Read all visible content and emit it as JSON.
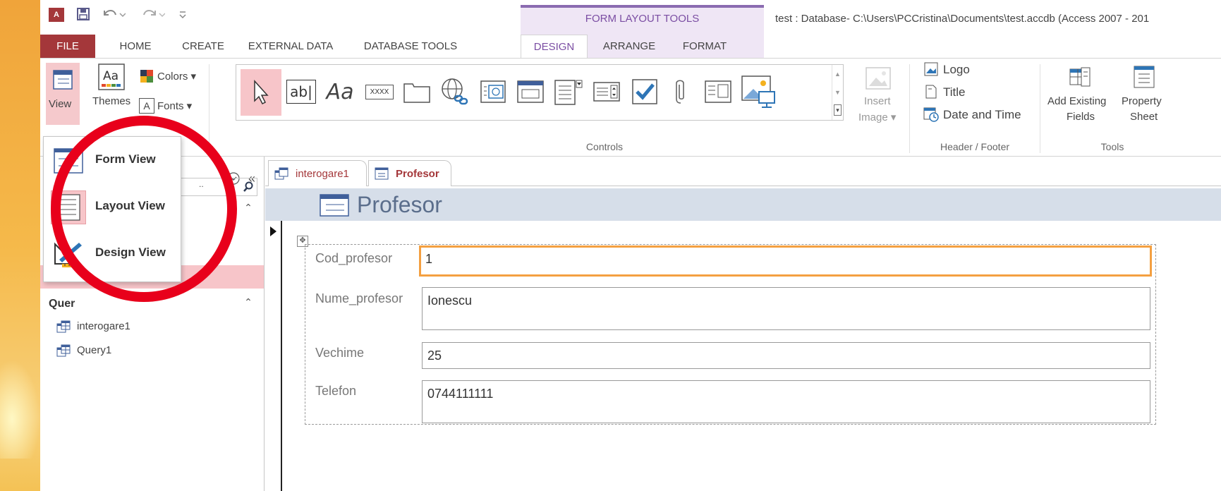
{
  "window": {
    "context_group": "FORM LAYOUT TOOLS",
    "title": "test : Database- C:\\Users\\PCCristina\\Documents\\test.accdb (Access 2007 - 201",
    "app_logo": "A"
  },
  "tabs": {
    "file": "FILE",
    "home": "HOME",
    "create": "CREATE",
    "external_data": "EXTERNAL DATA",
    "database_tools": "DATABASE TOOLS",
    "design": "DESIGN",
    "arrange": "ARRANGE",
    "format": "FORMAT"
  },
  "ribbon": {
    "view": "View",
    "themes": "Themes",
    "colors": "Colors",
    "fonts": "Fonts",
    "controls_label": "Controls",
    "insert_image_1": "Insert",
    "insert_image_2": "Image",
    "logo": "Logo",
    "title": "Title",
    "date_time": "Date and Time",
    "header_footer_label": "Header / Footer",
    "add_existing_1": "Add Existing",
    "add_existing_2": "Fields",
    "property_1": "Property",
    "property_2": "Sheet",
    "tools_label": "Tools",
    "textbox_glyph": "ab|",
    "label_glyph": "Aa",
    "xxxx_glyph": "XXXX"
  },
  "view_menu": {
    "form_view": "Form View",
    "layout_view": "Layout View",
    "design_view": "Design View"
  },
  "nav": {
    "queries_header": "Quer",
    "items": [
      "interogare1",
      "Query1"
    ]
  },
  "doc_tabs": [
    "interogare1",
    "Profesor"
  ],
  "form": {
    "title": "Profesor",
    "fields": [
      {
        "label": "Cod_profesor",
        "value": "1"
      },
      {
        "label": "Nume_profesor",
        "value": "Ionescu"
      },
      {
        "label": "Vechime",
        "value": "25"
      },
      {
        "label": "Telefon",
        "value": "0744111111"
      }
    ]
  },
  "colors": {
    "access_red": "#a4373a",
    "context_purple": "#7b4ea3",
    "highlight_pink": "#f7c5c9",
    "focus_orange": "#f4a041",
    "annotation_red": "#e8001b"
  }
}
